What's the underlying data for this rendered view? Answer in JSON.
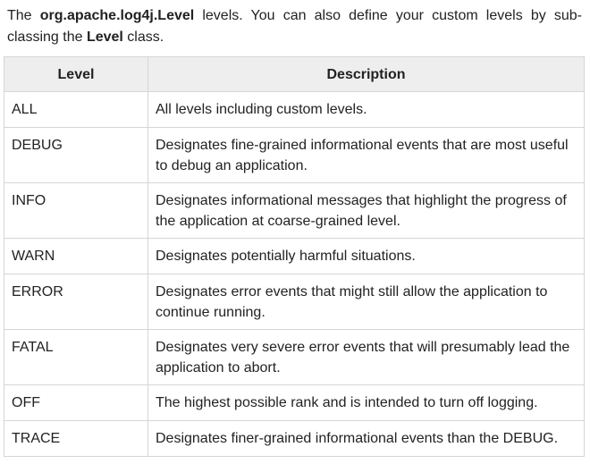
{
  "intro": {
    "part1": "The ",
    "class_name": "org.apache.log4j.Level",
    "part2": " levels. You can also define your custom levels by sub-classing the ",
    "level_word": "Level",
    "part3": " class."
  },
  "table": {
    "headers": [
      "Level",
      "Description"
    ],
    "rows": [
      {
        "level": "ALL",
        "description": "All levels including custom levels."
      },
      {
        "level": "DEBUG",
        "description": "Designates fine-grained informational events that are most useful to debug an application."
      },
      {
        "level": "INFO",
        "description": "Designates informational messages that highlight the progress of the application at coarse-grained level."
      },
      {
        "level": "WARN",
        "description": "Designates potentially harmful situations."
      },
      {
        "level": "ERROR",
        "description": "Designates error events that might still allow the application to continue running."
      },
      {
        "level": "FATAL",
        "description": "Designates very severe error events that will presumably lead the application to abort."
      },
      {
        "level": "OFF",
        "description": "The highest possible rank and is intended to turn off logging."
      },
      {
        "level": "TRACE",
        "description": "Designates finer-grained informational events than the DEBUG."
      }
    ]
  },
  "colors": {
    "header_bg": "#eeeeee",
    "border": "#d6d6d6",
    "text": "#222222"
  }
}
